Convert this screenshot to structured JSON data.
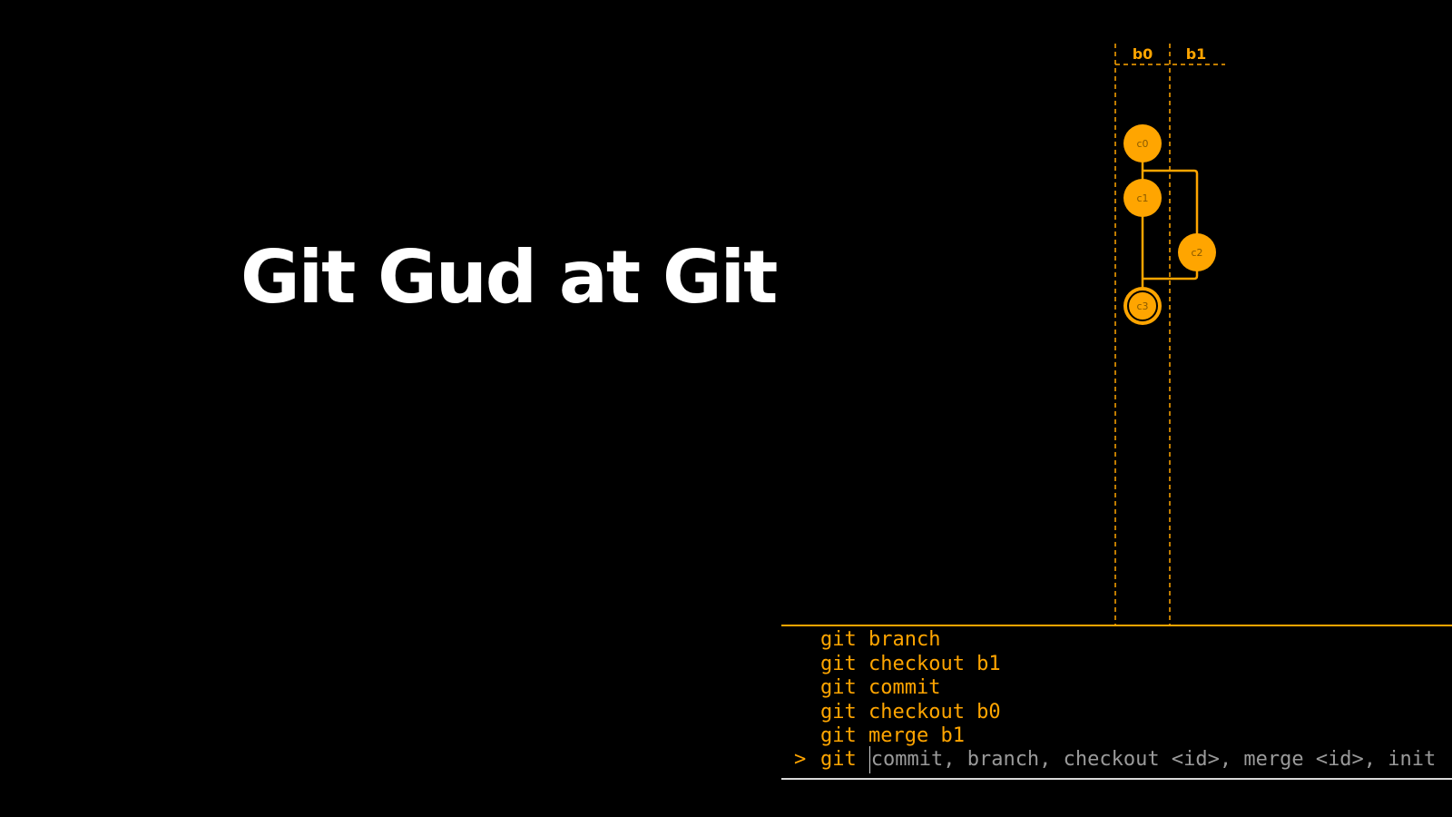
{
  "slide": {
    "title": "Git Gud at Git"
  },
  "branches": [
    {
      "name": "b0"
    },
    {
      "name": "b1"
    }
  ],
  "commits": [
    {
      "id": "c0",
      "branch": "b0"
    },
    {
      "id": "c1",
      "branch": "b0"
    },
    {
      "id": "c2",
      "branch": "b1"
    },
    {
      "id": "c3",
      "branch": "b0",
      "current": true
    }
  ],
  "terminal": {
    "history": [
      "git branch",
      "git checkout b1",
      "git commit",
      "git checkout b0",
      "git merge b1"
    ],
    "prompt_symbol": ">",
    "prompt_prefix": "git",
    "input_hint": "commit, branch, checkout <id>, merge <id>, init"
  },
  "colors": {
    "accent": "#ffa500",
    "commit_label": "#8a5a00",
    "background": "#000000",
    "title": "#ffffff"
  }
}
